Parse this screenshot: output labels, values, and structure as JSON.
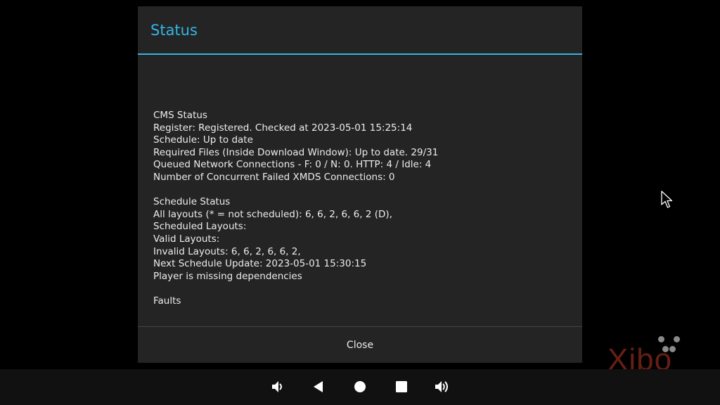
{
  "dialog": {
    "title": "Status",
    "close_label": "Close",
    "lines": [
      "CMS Status",
      "Register: Registered. Checked at 2023-05-01 15:25:14",
      "Schedule: Up to date",
      "Required Files (Inside Download Window): Up to date. 29/31",
      "Queued Network Connections - F: 0 / N: 0. HTTP: 4 / Idle: 4",
      "Number of Concurrent Failed XMDS Connections: 0",
      "",
      "Schedule Status",
      "All layouts (* = not scheduled): 6, 6, 2, 6, 6, 2 (D),",
      "Scheduled Layouts:",
      "Valid Layouts:",
      "Invalid Layouts: 6, 6, 2, 6, 6, 2,",
      "Next Schedule Update: 2023-05-01 15:30:15",
      "Player is missing dependencies",
      "",
      "Faults"
    ]
  },
  "watermark": {
    "text": "Xibo"
  },
  "navbar": {
    "icons": [
      "volume-down-icon",
      "back-icon",
      "home-icon",
      "recents-icon",
      "volume-up-icon"
    ]
  },
  "colors": {
    "accent": "#33b5e5",
    "dialog_bg": "#242424",
    "navbar_bg": "#111111",
    "text": "#ececec"
  }
}
